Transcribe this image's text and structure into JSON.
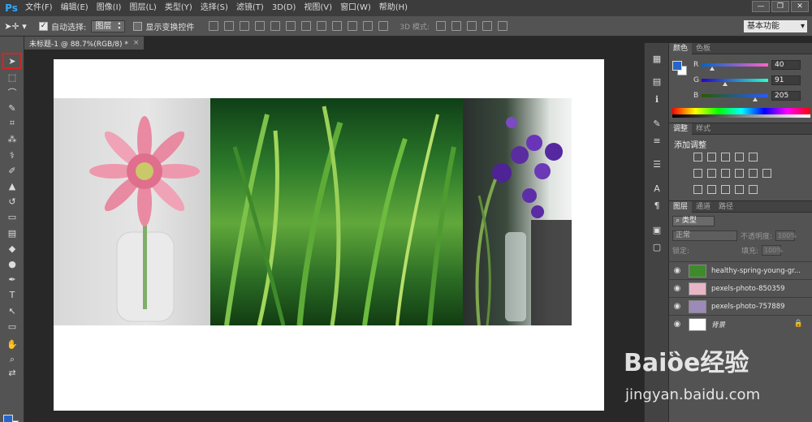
{
  "app": {
    "logo": "Ps"
  },
  "menu": [
    "文件(F)",
    "编辑(E)",
    "图像(I)",
    "图层(L)",
    "类型(Y)",
    "选择(S)",
    "滤镜(T)",
    "3D(D)",
    "视图(V)",
    "窗口(W)",
    "帮助(H)"
  ],
  "window_controls": {
    "minimize": "—",
    "restore": "❐",
    "close": "✕"
  },
  "options_bar": {
    "tool_icon": "move-tool-icon",
    "auto_select_label": "自动选择:",
    "auto_select_checked": true,
    "auto_select_target": "图层",
    "transform_label": "显示变换控件",
    "transform_checked": false,
    "mode_3d_label": "3D 模式:",
    "workspace": "基本功能"
  },
  "document": {
    "tab_title": "未标题-1 @ 88.7%(RGB/8) *",
    "close": "×"
  },
  "color_panel": {
    "tabs": [
      "颜色",
      "色板"
    ],
    "foreground": "#2864c8",
    "background": "#ffffff",
    "r": "40",
    "g": "91",
    "b": "205",
    "r_fraction": 0.157,
    "g_fraction": 0.357,
    "b_fraction": 0.804
  },
  "adjustments_panel": {
    "tabs": [
      "调整",
      "样式"
    ],
    "title": "添加调整"
  },
  "layers_panel": {
    "tabs": [
      "图层",
      "通道",
      "路径"
    ],
    "filter": "⌕ 类型",
    "blend_mode": "正常",
    "opacity_label": "不透明度:",
    "opacity": "100%",
    "lock_label": "锁定:",
    "fill_label": "填充:",
    "fill": "100%",
    "layers": [
      {
        "name": "healthy-spring-young-gr...",
        "visible": true
      },
      {
        "name": "pexels-photo-850359",
        "visible": true
      },
      {
        "name": "pexels-photo-757889",
        "visible": true
      },
      {
        "name": "背景",
        "visible": true,
        "locked": true
      }
    ]
  },
  "watermark": {
    "logo": "Baiὃe经验",
    "url": "jingyan.baidu.com"
  }
}
